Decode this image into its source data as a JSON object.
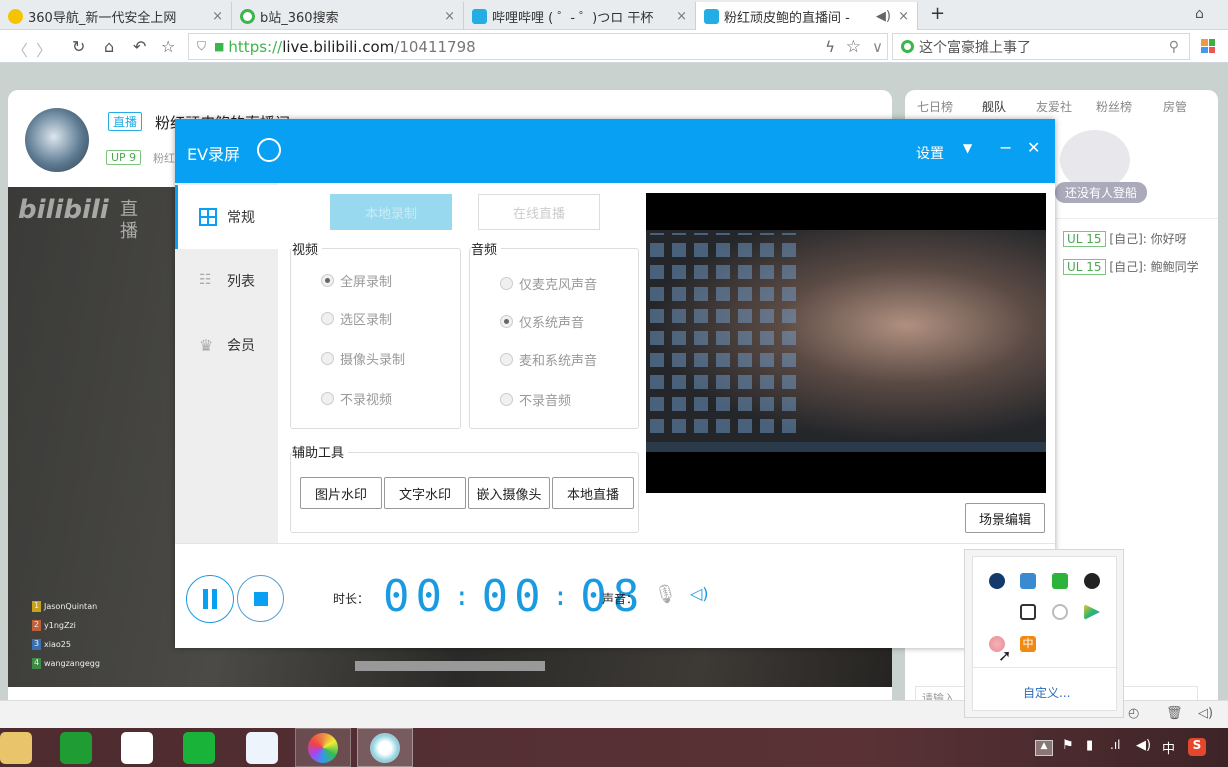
{
  "browser": {
    "tabs": [
      {
        "title": "360导航_新一代安全上网",
        "icon_color": "#f5c400"
      },
      {
        "title": "b站_360搜索",
        "icon_color": "#3cb54a"
      },
      {
        "title": "哔哩哔哩 ( ゜- ゜)つロ 干杯",
        "icon_color": "#23ade5"
      },
      {
        "title": "粉红顽皮鲍的直播间 - ",
        "icon_color": "#23ade5",
        "active": true
      }
    ],
    "new_tab": "+",
    "url_protocol": "https://",
    "url_host": "live.bilibili.com",
    "url_path": "/10411798",
    "search_placeholder": "这个富豪摊上事了"
  },
  "room": {
    "live_badge": "直播",
    "title": "粉红顽皮鲍的直播间",
    "up_level": "UP 9",
    "streamer_short": "粉红",
    "watermark_logo": "bilibili",
    "watermark_text": "直播",
    "leaderboard": [
      {
        "rank": "1",
        "name": "JasonQuintan",
        "color": "#c9a21a"
      },
      {
        "rank": "2",
        "name": "y1ngZzi",
        "color": "#c0603a"
      },
      {
        "rank": "3",
        "name": "xiao25",
        "color": "#3a6fb0"
      },
      {
        "rank": "4",
        "name": "wangzangegg",
        "color": "#3f8a46"
      }
    ]
  },
  "right_panel": {
    "tabs": [
      "七日榜",
      "舰队",
      "友爱社",
      "粉丝榜",
      "房管"
    ],
    "active_tab": "舰队",
    "empty_text": "还没有人登船",
    "chat": [
      {
        "level": "UL 15",
        "user": "[自己]",
        "text": ": 你好呀"
      },
      {
        "level": "UL 15",
        "user": "[自己]",
        "text": ": 鲍鲍同学"
      }
    ],
    "input_placeholder": "请输入"
  },
  "ev": {
    "title": "EV录屏",
    "settings": "设置",
    "accent": "#08a0f3",
    "sidebar": [
      {
        "label": "常规",
        "icon": "grid-icon",
        "selected": true
      },
      {
        "label": "列表",
        "icon": "list-icon"
      },
      {
        "label": "会员",
        "icon": "crown-icon"
      }
    ],
    "mode_buttons": {
      "local": "本地录制",
      "online": "在线直播"
    },
    "video": {
      "label": "视频",
      "options": [
        "全屏录制",
        "选区录制",
        "摄像头录制",
        "不录视频"
      ],
      "selected": 0
    },
    "audio": {
      "label": "音频",
      "options": [
        "仅麦克风声音",
        "仅系统声音",
        "麦和系统声音",
        "不录音频"
      ],
      "selected": 1
    },
    "tools": {
      "label": "辅助工具",
      "buttons": [
        "图片水印",
        "文字水印",
        "嵌入摄像头",
        "本地直播"
      ]
    },
    "scene_edit": "场景编辑",
    "duration_label": "时长：",
    "duration": {
      "h": "00",
      "m": "00",
      "s": "08"
    },
    "sound_label": "声音："
  },
  "tray": {
    "customize": "自定义...",
    "ime": "中"
  }
}
